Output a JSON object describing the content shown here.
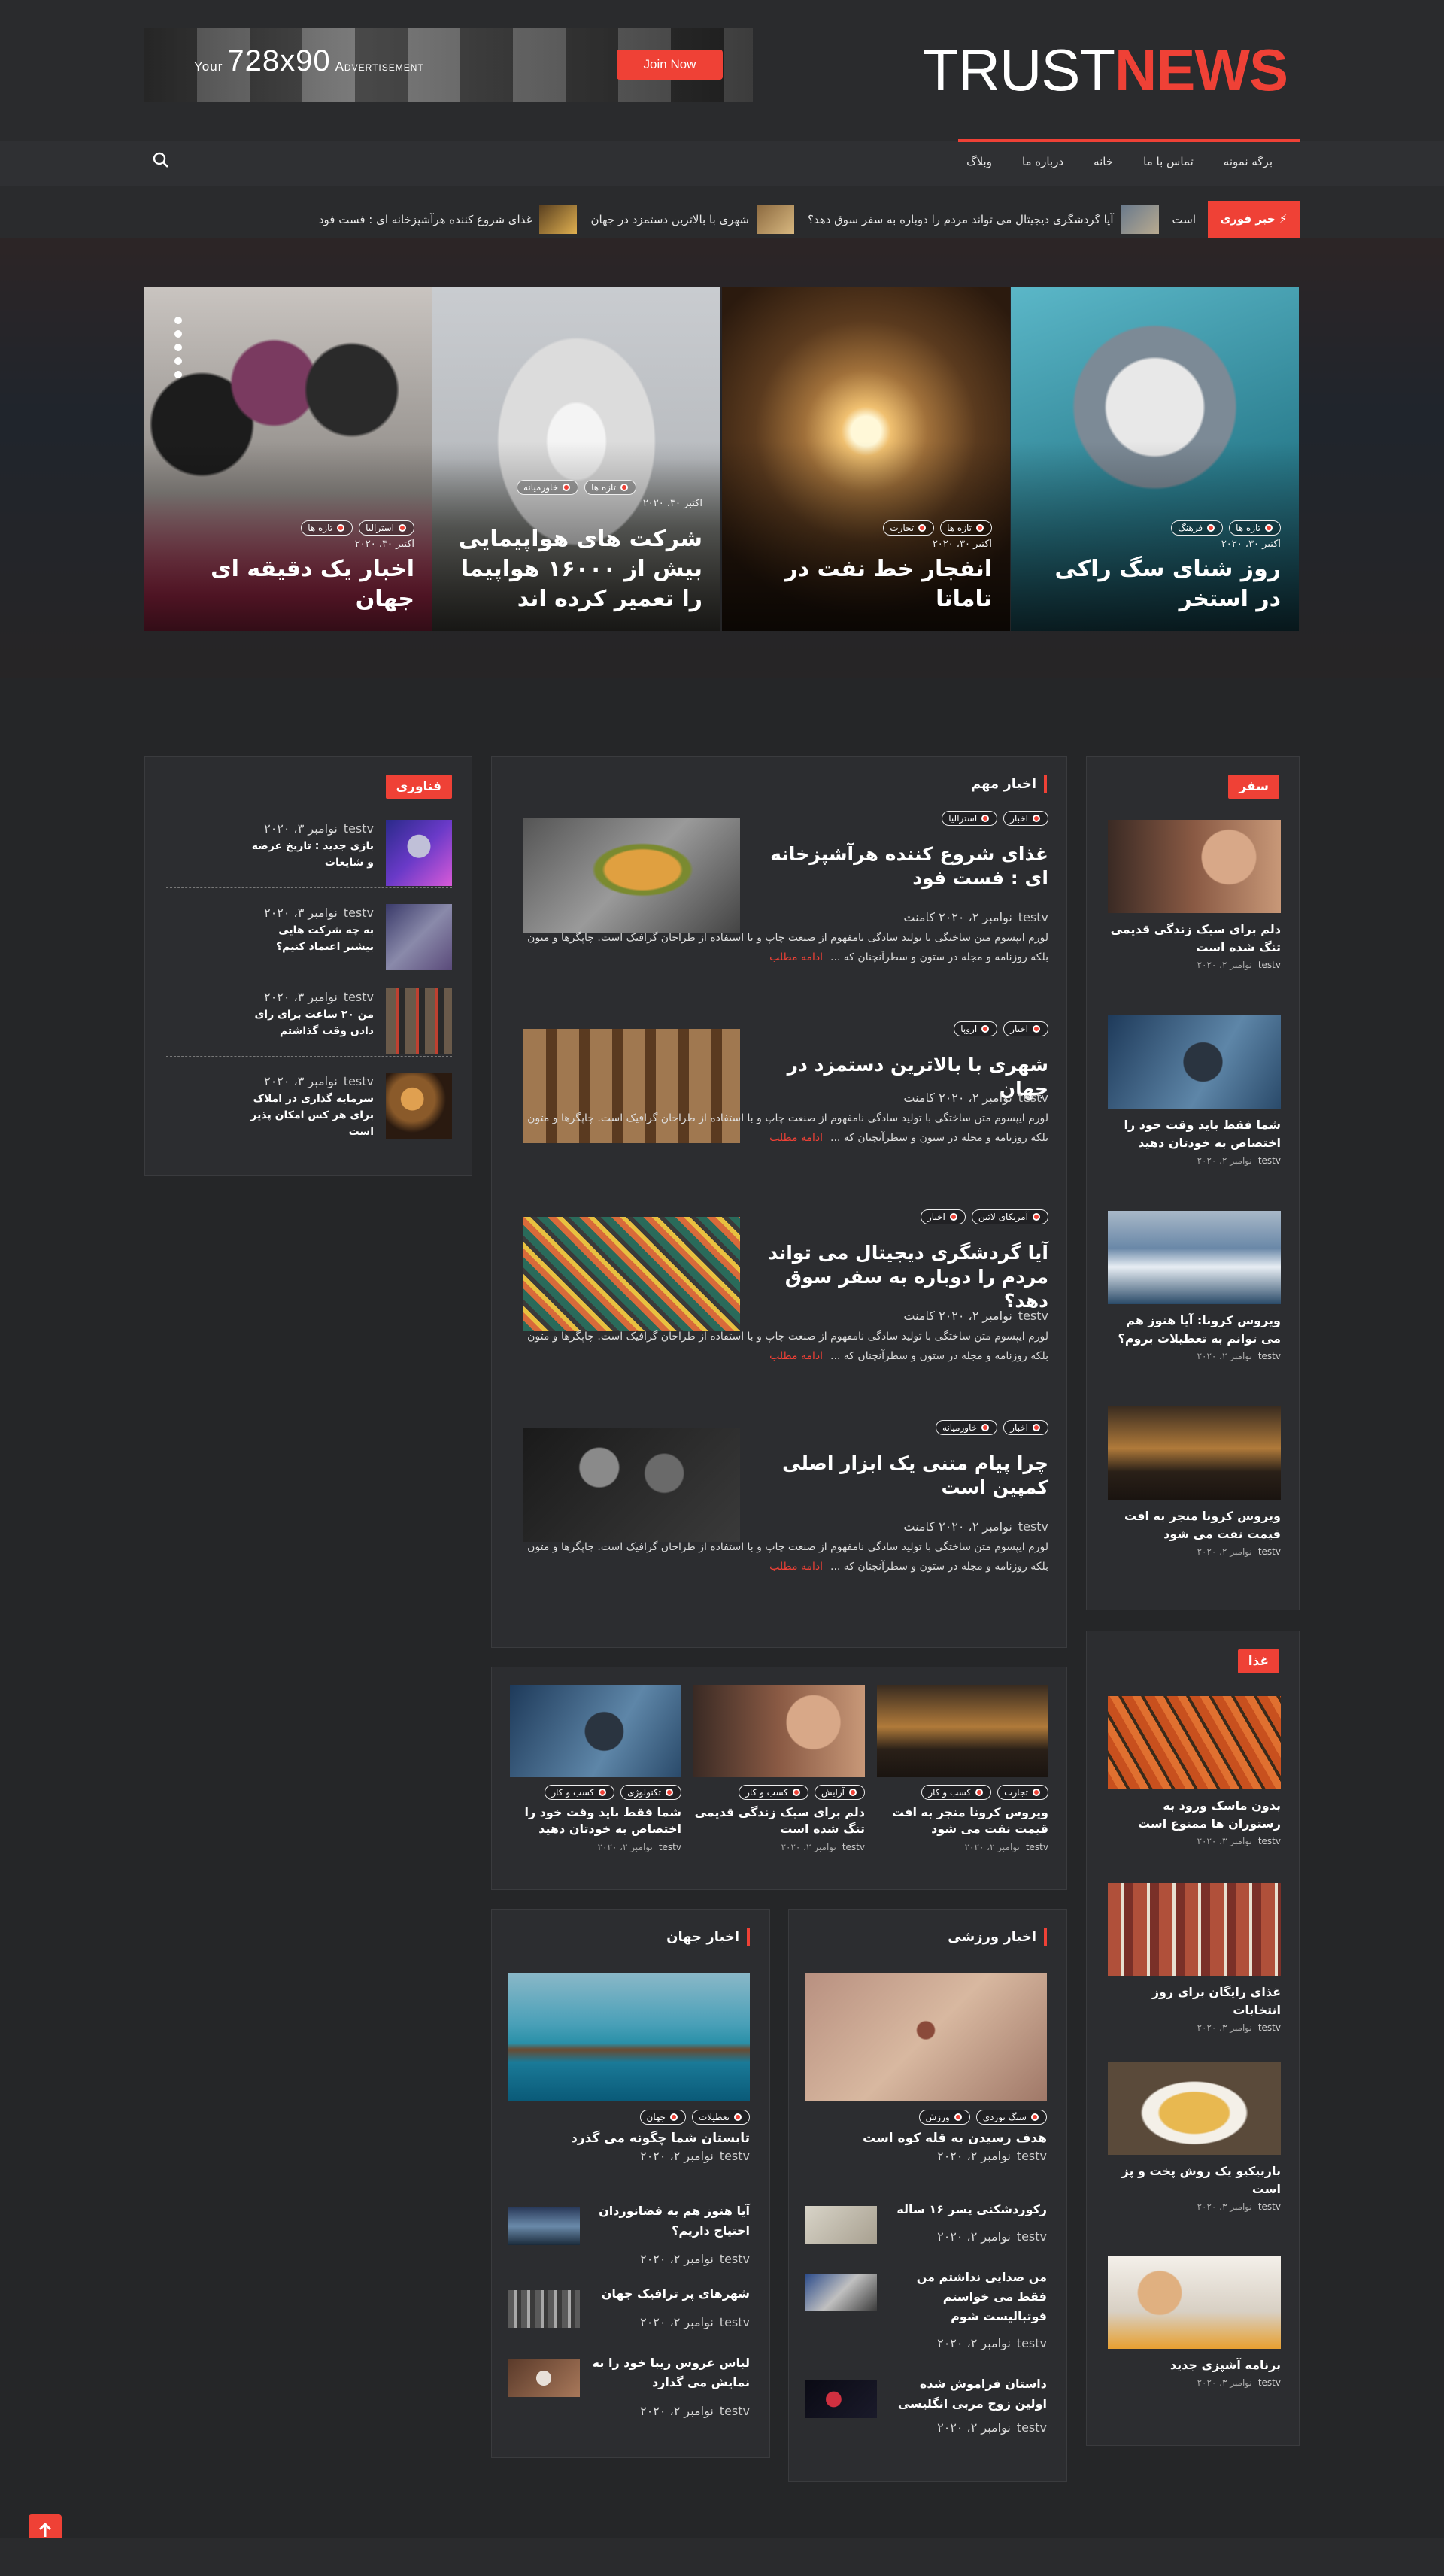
{
  "brand": {
    "part1": "TRUST",
    "part2": "NEWS"
  },
  "ad": {
    "prefix": "Your",
    "size": "728x90",
    "suffix": "Advertisement",
    "button": "Join Now"
  },
  "nav": {
    "items": [
      "برگه نمونه",
      "تماس با ما",
      "خانه",
      "درباره ما",
      "وبلاگ"
    ]
  },
  "ticker": {
    "label": "خبر فوری",
    "items": [
      "است",
      "آیا گردشگری دیجیتال می تواند مردم را دوباره به سفر سوق دهد؟",
      "شهری با بالاترین دستمزد در جهان",
      "غذای شروع کننده هرآشپزخانه ای : فست فود"
    ]
  },
  "hero": {
    "slides": [
      {
        "title": "روز شنای سگ راکی در استخر",
        "date": "اکتبر ۳۰، ۲۰۲۰",
        "tags": [
          "تازه ها",
          "فرهنگ"
        ]
      },
      {
        "title": "انفجار خط نفت در تاماتا",
        "date": "اکتبر ۳۰، ۲۰۲۰",
        "tags": [
          "تازه ها",
          "تجارت"
        ]
      },
      {
        "title": "شرکت های هواپیمایی بیش از ۱۶۰۰۰ هواپیما را تعمیر کرده اند",
        "date": "اکتبر ۳۰، ۲۰۲۰",
        "tags": [
          "تازه ها",
          "خاورمیانه"
        ]
      },
      {
        "title": "اخبار یک دقیقه ای جهان",
        "date": "اکتبر ۳۰، ۲۰۲۰",
        "tags": [
          "تازه ها",
          "استرالیا"
        ]
      }
    ]
  },
  "travel": {
    "title": "سفر",
    "items": [
      {
        "title": "دلم برای سبک زندگی قدیمی تنگ شده است",
        "author": "testv",
        "date": "نوامبر ۲، ۲۰۲۰"
      },
      {
        "title": "شما فقط باید وقت خود را اختصاص به خودتان دهید",
        "author": "testv",
        "date": "نوامبر ۲، ۲۰۲۰"
      },
      {
        "title": "ویروس کرونا: آیا هنوز هم می توانم به تعطیلات بروم؟",
        "author": "testv",
        "date": "نوامبر ۲، ۲۰۲۰"
      },
      {
        "title": "ویروس کرونا منجر به افت قیمت نفت می شود",
        "author": "testv",
        "date": "نوامبر ۲، ۲۰۲۰"
      }
    ]
  },
  "food": {
    "title": "غذا",
    "items": [
      {
        "title": "بدون ماسک ورود به رستوران ها ممنوع است",
        "author": "testv",
        "date": "نوامبر ۳، ۲۰۲۰"
      },
      {
        "title": "غذای رایگان برای روز انتخابات",
        "author": "testv",
        "date": "نوامبر ۳، ۲۰۲۰"
      },
      {
        "title": "باربیکیو یک روش پخت و پز است",
        "author": "testv",
        "date": "نوامبر ۳، ۲۰۲۰"
      },
      {
        "title": "برنامه آشپزی جدید",
        "author": "testv",
        "date": "نوامبر ۳، ۲۰۲۰"
      }
    ]
  },
  "important": {
    "title": "اخبار مهم",
    "more": "ادامه مطلب",
    "posts": [
      {
        "title": "غذای شروع کننده هرآشپزخانه ای : فست فود",
        "tags": [
          "اخبار",
          "استرالیا"
        ],
        "author": "testv",
        "date": "نوامبر ۲، ۲۰۲۰",
        "comments": "کامنت",
        "excerpt": "لورم ایپسوم متن ساختگی با تولید سادگی نامفهوم از صنعت چاپ و با استفاده از طراحان گرافیک است. چاپگرها و متون بلکه روزنامه و مجله در ستون و سطرآنچنان که ..."
      },
      {
        "title": "شهری با بالاترین دستمزد در جهان",
        "tags": [
          "اخبار",
          "اروپا"
        ],
        "author": "testv",
        "date": "نوامبر ۲، ۲۰۲۰",
        "comments": "کامنت",
        "excerpt": "لورم ایپسوم متن ساختگی با تولید سادگی نامفهوم از صنعت چاپ و با استفاده از طراحان گرافیک است. چاپگرها و متون بلکه روزنامه و مجله در ستون و سطرآنچنان که ..."
      },
      {
        "title": "آیا گردشگری دیجیتال می تواند مردم را دوباره به سفر سوق دهد؟",
        "tags": [
          "آمریکای لاتین",
          "اخبار"
        ],
        "author": "testv",
        "date": "نوامبر ۲، ۲۰۲۰",
        "comments": "کامنت",
        "excerpt": "لورم ایپسوم متن ساختگی با تولید سادگی نامفهوم از صنعت چاپ و با استفاده از طراحان گرافیک است. چاپگرها و متون بلکه روزنامه و مجله در ستون و سطرآنچنان که ..."
      },
      {
        "title": "چرا پیام متنی یک ابزار اصلی کمپین است",
        "tags": [
          "اخبار",
          "خاورمیانه"
        ],
        "author": "testv",
        "date": "نوامبر ۲، ۲۰۲۰",
        "comments": "کامنت",
        "excerpt": "لورم ایپسوم متن ساختگی با تولید سادگی نامفهوم از صنعت چاپ و با استفاده از طراحان گرافیک است. چاپگرها و متون بلکه روزنامه و مجله در ستون و سطرآنچنان که ..."
      }
    ]
  },
  "tech": {
    "title": "فناوری",
    "items": [
      {
        "title": "بازی جدید : تاریخ عرضه و شایعات",
        "author": "testv",
        "date": "نوامبر ۳، ۲۰۲۰"
      },
      {
        "title": "به چه شرکت هایی بیشتر اعتماد کنیم؟",
        "author": "testv",
        "date": "نوامبر ۳، ۲۰۲۰"
      },
      {
        "title": "من ۲۰ ساعت برای رای دادن وقت گذاشتم",
        "author": "testv",
        "date": "نوامبر ۳، ۲۰۲۰"
      },
      {
        "title": "سرمایه گذاری در املاک برای هر کس امکان پذیر است",
        "author": "testv",
        "date": "نوامبر ۳، ۲۰۲۰"
      }
    ]
  },
  "carousel": {
    "items": [
      {
        "title": "ویروس کرونا منجر به افت قیمت نفت می شود",
        "tags": [
          "تجارت",
          "کسب و کار"
        ],
        "author": "testv",
        "date": "نوامبر ۲، ۲۰۲۰"
      },
      {
        "title": "دلم برای سبک زندگی قدیمی تنگ شده است",
        "tags": [
          "آرایش",
          "کسب و کار"
        ],
        "author": "testv",
        "date": "نوامبر ۲، ۲۰۲۰"
      },
      {
        "title": "شما فقط باید وقت خود را اختصاص به خودتان دهید",
        "tags": [
          "تکنولوژی",
          "کسب و کار"
        ],
        "author": "testv",
        "date": "نوامبر ۲، ۲۰۲۰"
      }
    ]
  },
  "sports": {
    "title": "اخبار ورزشی",
    "first": {
      "title": "هدف رسیدن به قله کوه است",
      "tags": [
        "سنگ نوردی",
        "ورزش"
      ],
      "author": "testv",
      "date": "نوامبر ۲، ۲۰۲۰"
    },
    "items": [
      {
        "title": "رکوردشکنی پسر ۱۶ ساله",
        "author": "testv",
        "date": "نوامبر ۲، ۲۰۲۰"
      },
      {
        "title": "من صدایی نداشتم من فقط می خواستم فوتبالیست شوم",
        "author": "testv",
        "date": "نوامبر ۲، ۲۰۲۰"
      },
      {
        "title": "داستان فراموش شده اولین زوج مربی انگلیسی",
        "author": "testv",
        "date": "نوامبر ۲، ۲۰۲۰"
      }
    ]
  },
  "world": {
    "title": "اخبار جهان",
    "first": {
      "title": "تابستان شما چگونه می گذرد",
      "tags": [
        "تعطیلات",
        "جهان"
      ],
      "author": "testv",
      "date": "نوامبر ۲، ۲۰۲۰"
    },
    "items": [
      {
        "title": "آیا هنوز هم به فضانوردان احتیاج داریم؟",
        "author": "testv",
        "date": "نوامبر ۲، ۲۰۲۰"
      },
      {
        "title": "شهرهای پر ترافیک جهان",
        "author": "testv",
        "date": "نوامبر ۲، ۲۰۲۰"
      },
      {
        "title": "لباس عروس زیبا خود را به نمایش می گذارد",
        "author": "testv",
        "date": "نوامبر ۲، ۲۰۲۰"
      }
    ]
  },
  "icons": {
    "search": "search-icon",
    "bolt": "bolt-icon",
    "totop": "arrow-up-icon",
    "prev": "chevron-left-icon",
    "next": "chevron-right-icon"
  },
  "colors": {
    "accent": "#ef4136",
    "bg": "#252628",
    "panel": "#2c2d30"
  }
}
